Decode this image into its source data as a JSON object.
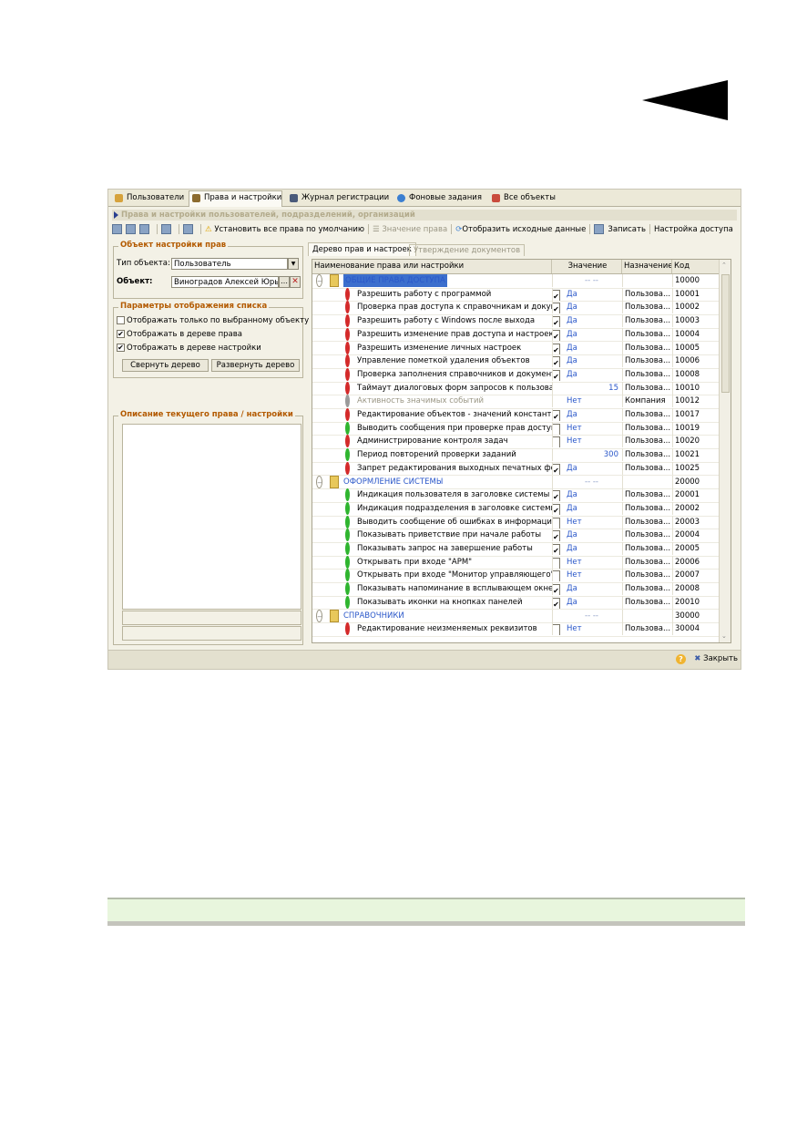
{
  "tabs": [
    {
      "label": "Пользователи",
      "icon": "user-icon",
      "color": "#d6a23c"
    },
    {
      "label": "Права и настройки",
      "icon": "key-person-icon",
      "color": "#8c6b2f"
    },
    {
      "label": "Журнал регистрации",
      "icon": "journal-icon",
      "color": "#4a5a7a"
    },
    {
      "label": "Фоновые задания",
      "icon": "clock-icon",
      "color": "#3b7fd1"
    },
    {
      "label": "Все объекты",
      "icon": "objects-icon",
      "color": "#c94b3c"
    }
  ],
  "header": {
    "title": "Права и настройки пользователей, подразделений, организаций"
  },
  "toolbar": {
    "set_defaults": "Установить все права по умолчанию",
    "right_value": "Значение права",
    "show_source": "Отобразить исходные данные",
    "save": "Записать",
    "access_settings": "Настройка доступа"
  },
  "left": {
    "object_group": "Объект настройки прав",
    "object_type_label": "Тип объекта:",
    "object_type_value": "Пользователь",
    "object_label": "Объект:",
    "object_value": "Виноградов Алексей Юрьеви",
    "params_group": "Параметры отображения списка",
    "opt1": "Отображать только по  выбранному объекту",
    "opt2": "Отображать в дереве права",
    "opt3": "Отображать в дереве настройки",
    "collapse_btn": "Свернуть дерево",
    "expand_btn": "Развернуть дерево",
    "desc_group": "Описание текущего права / настройки"
  },
  "right_tabs": [
    "Дерево прав и настроек",
    "Утверждение документов"
  ],
  "grid": {
    "headers": [
      "Наименование права или настройки",
      "Значение",
      "Назначение",
      "Код"
    ],
    "rows": [
      {
        "type": "group",
        "name": "ОБЩИЕ ПРАВА ДОСТУПА",
        "value": "-- --",
        "dest": "",
        "code": "10000",
        "selected": true
      },
      {
        "type": "item",
        "dot": "#d42a2a",
        "name": "Разрешить работу с программой",
        "chk": "✔",
        "value": "Да",
        "dest": "Пользова...",
        "code": "10001"
      },
      {
        "type": "item",
        "dot": "#d42a2a",
        "name": "Проверка прав доступа к справочникам и докуме...",
        "chk": "✔",
        "value": "Да",
        "dest": "Пользова...",
        "code": "10002"
      },
      {
        "type": "item",
        "dot": "#d42a2a",
        "name": "Разрешить работу с Windows после выхода",
        "chk": "✔",
        "value": "Да",
        "dest": "Пользова...",
        "code": "10003"
      },
      {
        "type": "item",
        "dot": "#d42a2a",
        "name": "Разрешить изменение прав доступа и настроек",
        "chk": "✔",
        "value": "Да",
        "dest": "Пользова...",
        "code": "10004"
      },
      {
        "type": "item",
        "dot": "#d42a2a",
        "name": "Разрешить изменение личных настроек",
        "chk": "✔",
        "value": "Да",
        "dest": "Пользова...",
        "code": "10005"
      },
      {
        "type": "item",
        "dot": "#d42a2a",
        "name": "Управление пометкой удаления объектов",
        "chk": "✔",
        "value": "Да",
        "dest": "Пользова...",
        "code": "10006"
      },
      {
        "type": "item",
        "dot": "#d42a2a",
        "name": "Проверка заполнения справочников и документов",
        "chk": "✔",
        "value": "Да",
        "dest": "Пользова...",
        "code": "10008"
      },
      {
        "type": "item",
        "dot": "#d42a2a",
        "name": "Таймаут диалоговых форм запросов к пользоват...",
        "chk": "",
        "value": "15",
        "num": true,
        "dest": "Пользова...",
        "code": "10010"
      },
      {
        "type": "item",
        "dot": "#9a9a9a",
        "name": "Активность значимых событий",
        "gray": true,
        "chk": "",
        "value": "Нет",
        "dest": "Компания",
        "code": "10012"
      },
      {
        "type": "item",
        "dot": "#d42a2a",
        "name": "Редактирование объектов - значений констант",
        "chk": "✔",
        "value": "Да",
        "dest": "Пользова...",
        "code": "10017"
      },
      {
        "type": "item",
        "dot": "#2fb52f",
        "name": "Выводить сообщения при проверке прав доступа",
        "chk": "empty",
        "value": "Нет",
        "dest": "Пользова...",
        "code": "10019"
      },
      {
        "type": "item",
        "dot": "#d42a2a",
        "name": "Администрирование контроля задач",
        "chk": "empty",
        "value": "Нет",
        "dest": "Пользова...",
        "code": "10020"
      },
      {
        "type": "item",
        "dot": "#2fb52f",
        "name": "Период повторений проверки заданий",
        "chk": "",
        "value": "300",
        "num": true,
        "dest": "Пользова...",
        "code": "10021"
      },
      {
        "type": "item",
        "dot": "#d42a2a",
        "name": "Запрет редактирования выходных печатных форм",
        "chk": "✔",
        "value": "Да",
        "dest": "Пользова...",
        "code": "10025"
      },
      {
        "type": "group",
        "name": "ОФОРМЛЕНИЕ СИСТЕМЫ",
        "value": "-- --",
        "dest": "",
        "code": "20000"
      },
      {
        "type": "item",
        "dot": "#2fb52f",
        "name": "Индикация пользователя в заголовке системы",
        "chk": "✔",
        "value": "Да",
        "dest": "Пользова...",
        "code": "20001"
      },
      {
        "type": "item",
        "dot": "#2fb52f",
        "name": "Индикация подразделения в заголовке системы",
        "chk": "✔",
        "value": "Да",
        "dest": "Пользова...",
        "code": "20002"
      },
      {
        "type": "item",
        "dot": "#2fb52f",
        "name": "Выводить сообщение об ошибках в информацион...",
        "chk": "empty",
        "value": "Нет",
        "dest": "Пользова...",
        "code": "20003"
      },
      {
        "type": "item",
        "dot": "#2fb52f",
        "name": "Показывать приветствие при начале работы",
        "chk": "✔",
        "value": "Да",
        "dest": "Пользова...",
        "code": "20004"
      },
      {
        "type": "item",
        "dot": "#2fb52f",
        "name": "Показывать запрос на завершение работы",
        "chk": "✔",
        "value": "Да",
        "dest": "Пользова...",
        "code": "20005"
      },
      {
        "type": "item",
        "dot": "#2fb52f",
        "name": "Открывать при входе \"АРМ\"",
        "chk": "empty",
        "value": "Нет",
        "dest": "Пользова...",
        "code": "20006"
      },
      {
        "type": "item",
        "dot": "#2fb52f",
        "name": "Открывать при входе \"Монитор управляющего\"",
        "chk": "empty",
        "value": "Нет",
        "dest": "Пользова...",
        "code": "20007"
      },
      {
        "type": "item",
        "dot": "#2fb52f",
        "name": "Показывать напоминание в всплывающем окне",
        "chk": "✔",
        "value": "Да",
        "dest": "Пользова...",
        "code": "20008"
      },
      {
        "type": "item",
        "dot": "#2fb52f",
        "name": "Показывать иконки на кнопках панелей",
        "chk": "✔",
        "value": "Да",
        "dest": "Пользова...",
        "code": "20010"
      },
      {
        "type": "group",
        "name": "СПРАВОЧНИКИ",
        "value": "-- --",
        "dest": "",
        "code": "30000"
      },
      {
        "type": "item",
        "dot": "#d42a2a",
        "name": "Редактирование неизменяемых реквизитов",
        "chk": "empty",
        "value": "Нет",
        "dest": "Пользова...",
        "code": "30004"
      }
    ]
  },
  "status": {
    "help": "?",
    "close": "Закрыть"
  }
}
